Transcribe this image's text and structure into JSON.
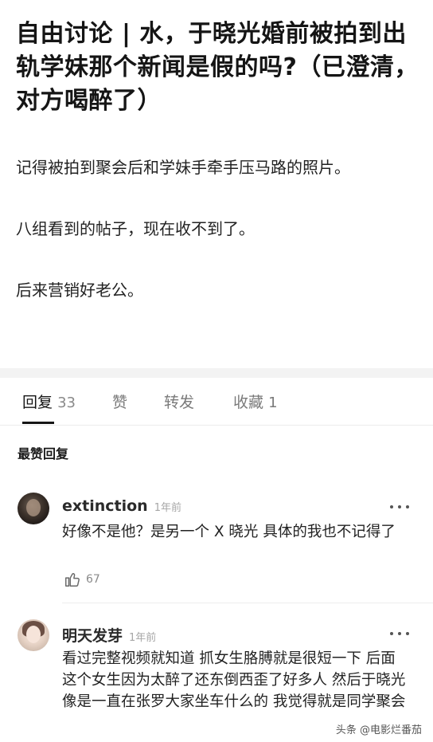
{
  "post": {
    "title": "自由讨论 | 水，于晓光婚前被拍到出轨学妹那个新闻是假的吗?（已澄清，对方喝醉了）",
    "paragraphs": [
      "记得被拍到聚会后和学妹手牵手压马路的照片。",
      "八组看到的帖子，现在收不到了。",
      "后来营销好老公。"
    ]
  },
  "tabs": [
    {
      "label": "回复",
      "count": "33"
    },
    {
      "label": "赞",
      "count": ""
    },
    {
      "label": "转发",
      "count": ""
    },
    {
      "label": "收藏",
      "count": "1"
    }
  ],
  "sort_label": "最赞回复",
  "comments": [
    {
      "user": "extinction",
      "time": "1年前",
      "text": "好像不是他？是另一个 X 晓光 具体的我也不记得了",
      "likes": "67"
    },
    {
      "user": "明天发芽",
      "time": "1年前",
      "text": "看过完整视频就知道 抓女生胳膊就是很短一下 后面这个女生因为太醉了还东倒西歪了好多人 然后于晓光像是一直在张罗大家坐车什么的 我觉得就是同学聚会"
    }
  ],
  "watermark": "头条 @电影烂番茄",
  "colors": {
    "accent": "#151515",
    "muted": "#7a7a7a",
    "gap": "#f3f3f3"
  }
}
